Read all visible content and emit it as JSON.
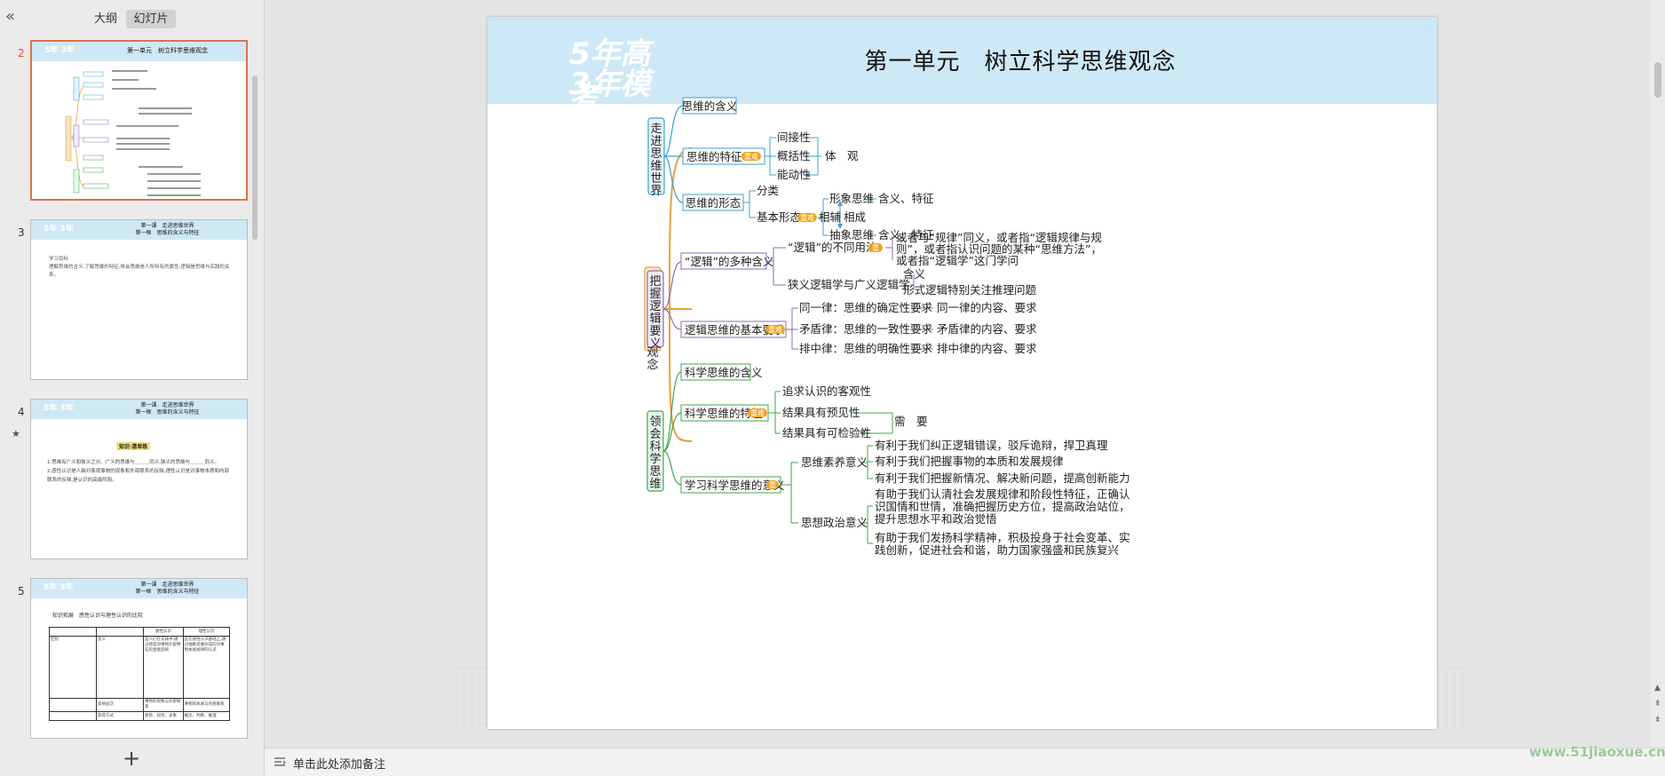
{
  "panel": {
    "collapse_icon": "«",
    "tab_outline": "大纲",
    "tab_slides": "幻灯片",
    "add_icon": "+",
    "star": "★"
  },
  "thumbs": [
    {
      "num": "2",
      "logo": "5年 3年",
      "title": "第一单元　树立科学思维观念"
    },
    {
      "num": "3",
      "logo": "5年 3年",
      "title": "第一课　走进思维世界\n第一框　思维的含义与特征",
      "body": "学习目标\n理解思维的含义,了解思维的特征,体会思维是人所特有的属性;逻辑是思维与实践的关系。"
    },
    {
      "num": "4",
      "logo": "5年 3年",
      "title": "第一课　走进思维世界\n第一框　思维的含义与特征",
      "tag": "知识·清单练",
      "body": "1.思维有广义和狭义之分。广义的思维与＿＿＿同义,狭义的思维与＿＿＿同义。\n2.感性认识是人脑对客观事物的现象和外部联系的反映,理性认识是对事物本质和内部联系的反映,是认识的高级阶段。"
    },
    {
      "num": "5",
      "logo": "5年 3年",
      "title": "第一课　走进思维世界\n第一框　思维的含义与特征",
      "body": "知识拓展　感性认识与理性认识的比较",
      "table_head": [
        "感性认识",
        "理性认识"
      ],
      "table_rows": [
        [
          "区别",
          "含义"
        ],
        [
          "",
          "反映层次"
        ],
        [
          "",
          "获得方式"
        ]
      ],
      "table_cells": [
        "是人们在实践中,通过感官对事物外部特征的直接反映",
        "是在感性认识基础上,通过抽象思维形成的对事物本质规律的认识",
        "事物的现象与外部联系",
        "事物的本质与内部联系",
        "感觉、知觉、表象",
        "概念、判断、推理"
      ]
    }
  ],
  "slide": {
    "logo_line1": "5年高考",
    "logo_line2": "3年模拟",
    "title": "第一单元　树立科学思维观念",
    "root": "树立科学思维观念",
    "branch1": {
      "label": "走进思维世界",
      "n1": "思维的含义",
      "n2": "思维的特征",
      "n2_badge": "重难",
      "traits": [
        "间接性",
        "概括性",
        "能动性"
      ],
      "traits_result": "体　观",
      "n3": "思维的形态",
      "classify": "分类",
      "basic": "基本形态",
      "basic_badge": "重难",
      "image_thinking": "形象思维",
      "image_detail": "含义、特征",
      "abstract_thinking": "抽象思维",
      "abstract_detail": "含义、特征",
      "relation_a": "相辅",
      "relation_b": "相成"
    },
    "branch2": {
      "label": "把握逻辑要义",
      "n1": "“逻辑”的多种含义",
      "usage": "“逻辑”的不同用法",
      "usage_badge": "重",
      "usage_text": [
        "或者与“规律”同义，或者指“逻辑规律与规",
        "则”，或者指认识问题的某种“思维方法”，",
        "或者指“逻辑学”这门学问"
      ],
      "narrow": "狭义逻辑学与广义逻辑学",
      "narrow_a": "含义",
      "narrow_b": "形式逻辑特别关注推理问题",
      "n2": "逻辑思维的基本要求",
      "n2_badge": "重难",
      "laws": [
        {
          "law": "同一律：思维的确定性要求",
          "content": "同一律的内容、要求"
        },
        {
          "law": "矛盾律：思维的一致性要求",
          "content": "矛盾律的内容、要求"
        },
        {
          "law": "排中律：思维的明确性要求",
          "content": "排中律的内容、要求"
        }
      ]
    },
    "branch3": {
      "label": "领会科学思维",
      "n1": "科学思维的含义",
      "n2": "科学思维的特征",
      "n2_badge": "重难",
      "features": [
        "追求认识的客观性",
        "结果具有预见性",
        "结果具有可检验性"
      ],
      "features_result": "需　要",
      "n3": "学习科学思维的意义",
      "n3_badge": "重",
      "literacy": "思维素养意义",
      "literacy_items": [
        "有利于我们纠正逻辑错误，驳斥诡辩，捍卫真理",
        "有利于我们把握事物的本质和发展规律",
        "有利于我们把握新情况、解决新问题，提高创新能力"
      ],
      "political": "思想政治意义",
      "political_a": [
        "有助于我们认清社会发展规律和阶段性特征，正确认",
        "识国情和世情，准确把握历史方位，提高政治站位，",
        "提升思想水平和政治觉悟"
      ],
      "political_b": [
        "有助于我们发扬科学精神，积极投身于社会变革、实",
        "践创新，促进社会和谐，助力国家强盛和民族复兴"
      ]
    }
  },
  "notes": {
    "placeholder": "单击此处添加备注"
  },
  "watermark": "www.51jiaoxue.cn",
  "colors": {
    "branch1": "#3aa0cc",
    "branch2": "#8c6bb1",
    "branch3": "#3fa64a",
    "root": "#e4a13b",
    "badge": "#f0a21d",
    "thumb_active": "#e0704a"
  }
}
